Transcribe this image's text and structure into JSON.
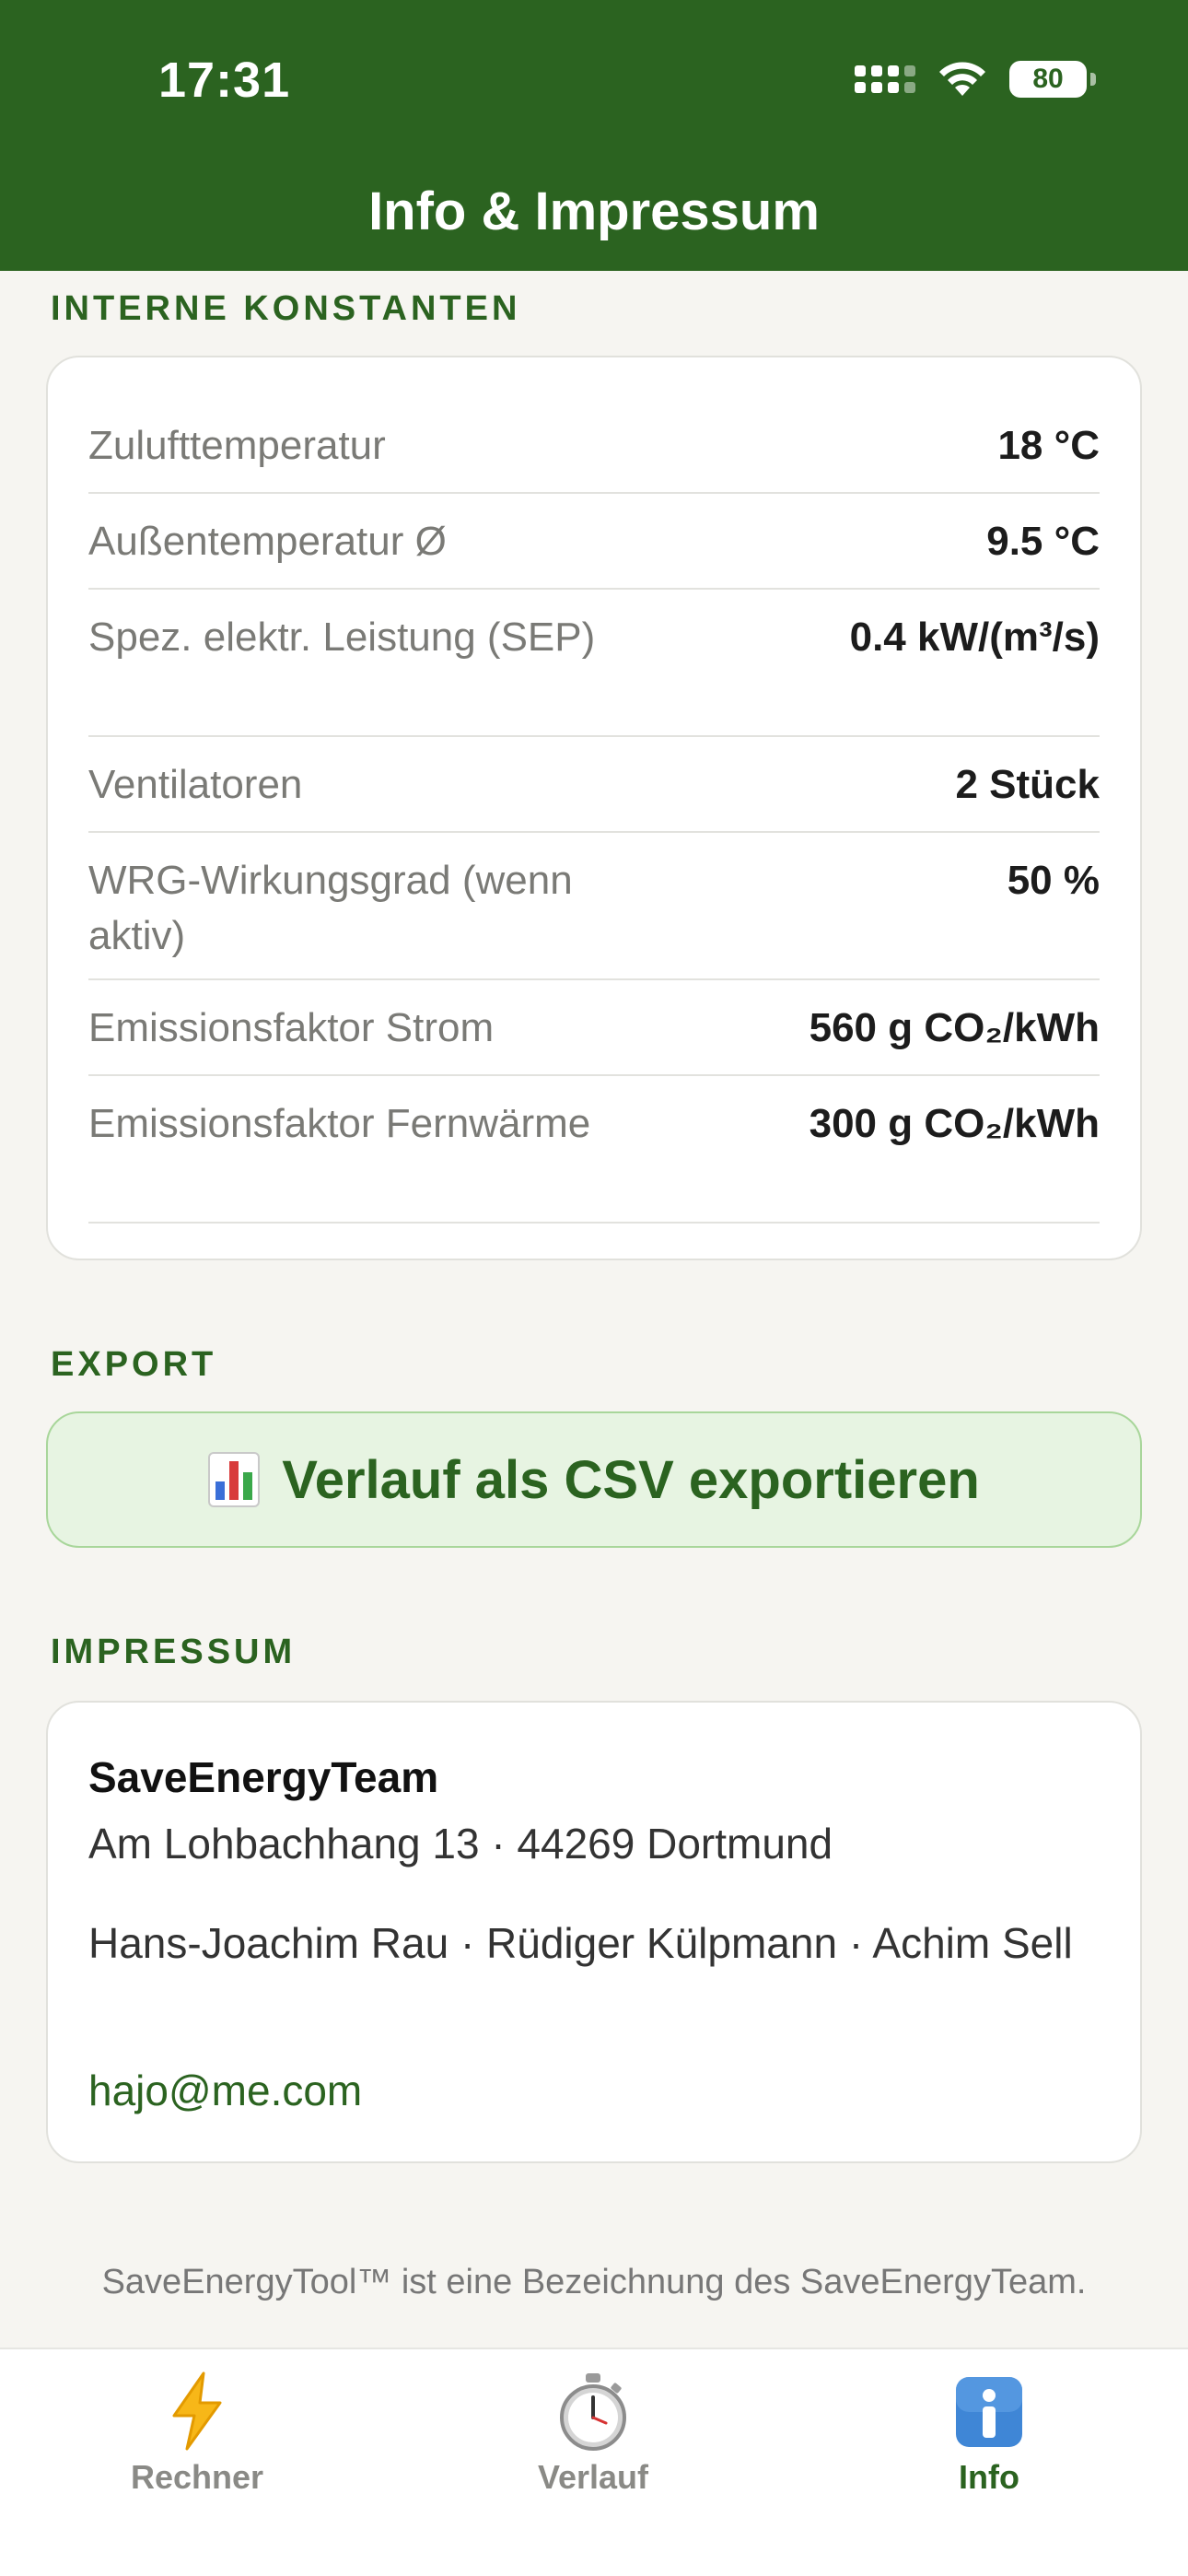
{
  "status_bar": {
    "time": "17:31",
    "battery": "80"
  },
  "header": {
    "title": "Info & Impressum"
  },
  "constants": {
    "section_label": "INTERNE KONSTANTEN",
    "rows": [
      {
        "label": "Zulufttemperatur",
        "value": "18 °C"
      },
      {
        "label": "Außentemperatur Ø",
        "value": "9.5 °C"
      },
      {
        "label": "Spez. elektr. Leistung (SEP)",
        "value": "0.4 kW/(m³/s)"
      },
      {
        "label": "Ventilatoren",
        "value": "2 Stück"
      },
      {
        "label": "WRG-Wirkungsgrad (wenn aktiv)",
        "value": "50 %"
      },
      {
        "label": "Emissionsfaktor Strom",
        "value": "560 g CO₂/kWh"
      },
      {
        "label": "Emissionsfaktor Fernwärme",
        "value": "300 g CO₂/kWh"
      }
    ]
  },
  "export": {
    "section_label": "EXPORT",
    "button_label": "Verlauf als CSV exportieren",
    "icon": "bar-chart-icon"
  },
  "impressum": {
    "section_label": "IMPRESSUM",
    "company": "SaveEnergyTeam",
    "address": "Am Lohbachhang 13 · 44269 Dortmund",
    "people": "Hans-Joachim Rau · Rüdiger Külpmann · Achim Sell",
    "email": "hajo@me.com"
  },
  "footer": {
    "note": "SaveEnergyTool™ ist eine Bezeichnung des SaveEnergyTeam."
  },
  "tabs": [
    {
      "label": "Rechner",
      "icon": "lightning-icon"
    },
    {
      "label": "Verlauf",
      "icon": "stopwatch-icon"
    },
    {
      "label": "Info",
      "icon": "info-icon",
      "active": true
    }
  ],
  "colors": {
    "brand": "#2b6320",
    "background": "#f6f5f1",
    "export_bg": "#e7f4e2"
  }
}
